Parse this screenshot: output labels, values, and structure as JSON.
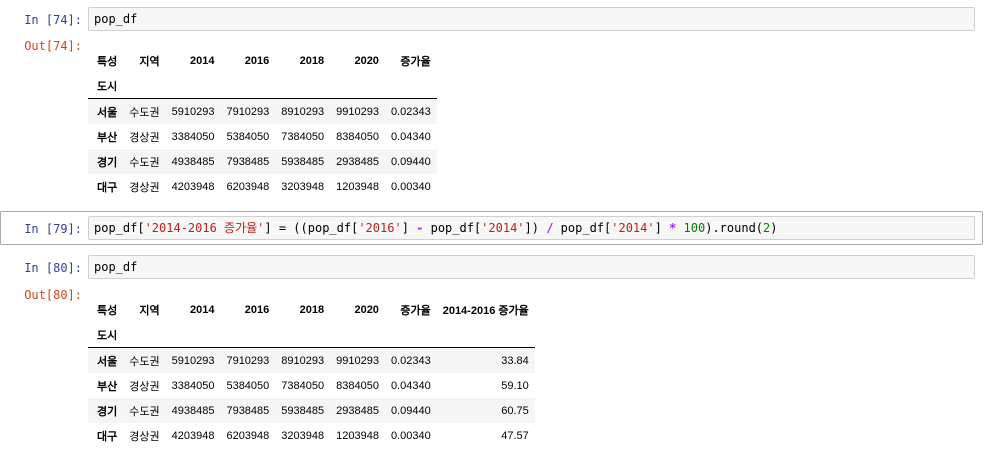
{
  "cells": {
    "c74": {
      "in_prompt": "In [74]:",
      "code": "pop_df",
      "out_prompt": "Out[74]:"
    },
    "c79": {
      "in_prompt": "In [79]:",
      "code_parts": {
        "p1": "pop_df[",
        "s1": "'2014-2016 증가율'",
        "p2": "] = ((pop_df[",
        "s2": "'2016'",
        "p3": "] ",
        "minus": "-",
        "p4": " pop_df[",
        "s3": "'2014'",
        "p5": "]) ",
        "div": "/",
        "p6": " pop_df[",
        "s4": "'2014'",
        "p7": "] ",
        "mul": "*",
        "p8": " ",
        "n100": "100",
        "p9": ").round(",
        "n2": "2",
        "p10": ")"
      }
    },
    "c80": {
      "in_prompt": "In [80]:",
      "code": "pop_df",
      "out_prompt": "Out[80]:"
    }
  },
  "table1": {
    "columns_label": "특성",
    "columns": [
      "지역",
      "2014",
      "2016",
      "2018",
      "2020",
      "증가율"
    ],
    "index_label": "도시",
    "rows": [
      {
        "index": "서울",
        "values": [
          "수도권",
          "5910293",
          "7910293",
          "8910293",
          "9910293",
          "0.02343"
        ]
      },
      {
        "index": "부산",
        "values": [
          "경상권",
          "3384050",
          "5384050",
          "7384050",
          "8384050",
          "0.04340"
        ]
      },
      {
        "index": "경기",
        "values": [
          "수도권",
          "4938485",
          "7938485",
          "5938485",
          "2938485",
          "0.09440"
        ]
      },
      {
        "index": "대구",
        "values": [
          "경상권",
          "4203948",
          "6203948",
          "3203948",
          "1203948",
          "0.00340"
        ]
      }
    ]
  },
  "table2": {
    "columns_label": "특성",
    "columns": [
      "지역",
      "2014",
      "2016",
      "2018",
      "2020",
      "증가율",
      "2014-2016 증가율"
    ],
    "index_label": "도시",
    "rows": [
      {
        "index": "서울",
        "values": [
          "수도권",
          "5910293",
          "7910293",
          "8910293",
          "9910293",
          "0.02343",
          "33.84"
        ]
      },
      {
        "index": "부산",
        "values": [
          "경상권",
          "3384050",
          "5384050",
          "7384050",
          "8384050",
          "0.04340",
          "59.10"
        ]
      },
      {
        "index": "경기",
        "values": [
          "수도권",
          "4938485",
          "7938485",
          "5938485",
          "2938485",
          "0.09440",
          "60.75"
        ]
      },
      {
        "index": "대구",
        "values": [
          "경상권",
          "4203948",
          "6203948",
          "3203948",
          "1203948",
          "0.00340",
          "47.57"
        ]
      }
    ]
  }
}
